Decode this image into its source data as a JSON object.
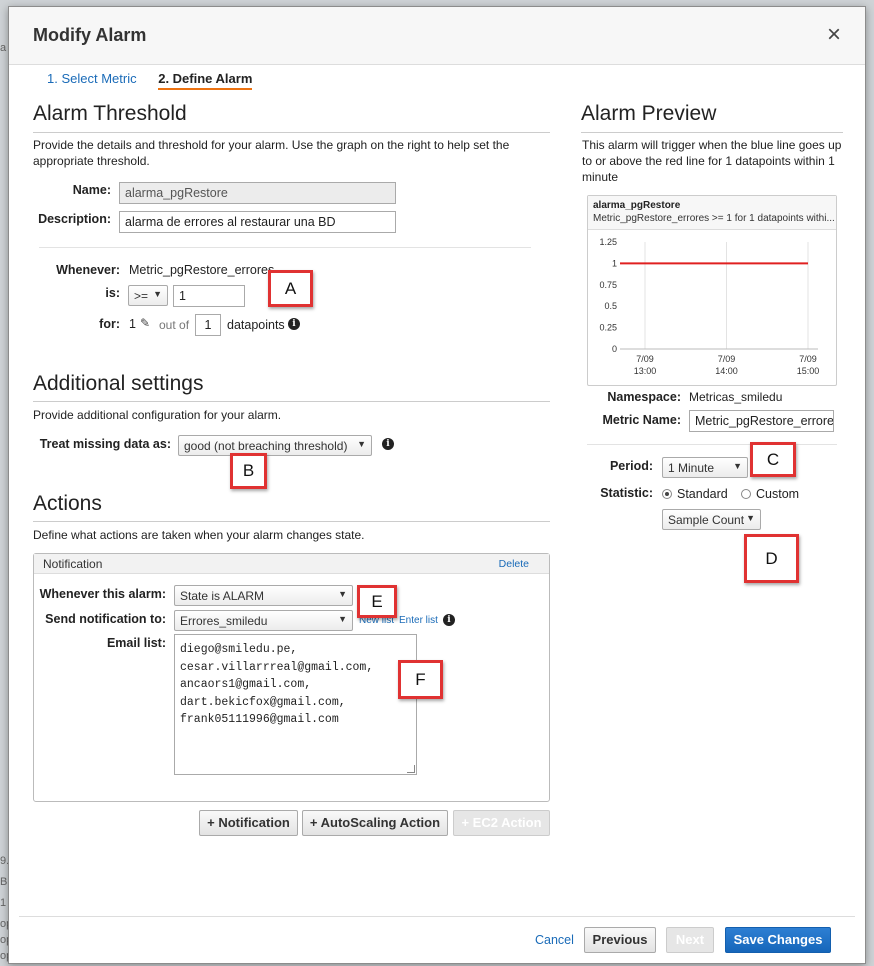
{
  "modal": {
    "title": "Modify Alarm",
    "close_glyph": "×"
  },
  "steps": [
    {
      "label": "1. Select Metric"
    },
    {
      "label": "2. Define Alarm"
    }
  ],
  "threshold": {
    "heading": "Alarm Threshold",
    "description": "Provide the details and threshold for your alarm. Use the graph on the right to help set the appropriate threshold.",
    "name_label": "Name:",
    "name_value": "alarma_pgRestore",
    "description_label": "Description:",
    "description_value": "alarma de errores al restaurar una BD",
    "whenever_label": "Whenever:",
    "whenever_value": "Metric_pgRestore_errores",
    "is_label": "is:",
    "operator": ">=",
    "threshold_value": "1",
    "for_label": "for:",
    "for_value": "1",
    "out_of": "out of",
    "datapoints_value": "1",
    "datapoints_label": "datapoints"
  },
  "additional": {
    "heading": "Additional settings",
    "description": "Provide additional configuration for your alarm.",
    "missing_label": "Treat missing data as:",
    "missing_value": "good (not breaching threshold)"
  },
  "actions": {
    "heading": "Actions",
    "description": "Define what actions are taken when your alarm changes state.",
    "notification_title": "Notification",
    "delete_label": "Delete",
    "whenever_alarm_label": "Whenever this alarm:",
    "state_value": "State is ALARM",
    "send_to_label": "Send notification to:",
    "topic_value": "Errores_smiledu",
    "new_list": "New list",
    "enter_list": "Enter list",
    "email_list_label": "Email list:",
    "emails": [
      "diego@smiledu.pe,",
      "cesar.villarrreal@gmail.com,",
      "ancaors1@gmail.com,",
      "dart.bekicfox@gmail.com,",
      "frank05111996@gmail.com"
    ],
    "add_notification": "+ Notification",
    "add_autoscaling": "+ AutoScaling Action",
    "add_ec2": "+ EC2 Action"
  },
  "preview": {
    "heading": "Alarm Preview",
    "description": "This alarm will trigger when the blue line goes up to or above the red line for 1 datapoints within 1 minute",
    "chart_title": "alarma_pgRestore",
    "chart_subtitle": "Metric_pgRestore_errores >= 1 for 1 datapoints withi...",
    "namespace_label": "Namespace:",
    "namespace_value": "Metricas_smiledu",
    "metric_name_label": "Metric Name:",
    "metric_name_value": "Metric_pgRestore_errores",
    "period_label": "Period:",
    "period_value": "1 Minute",
    "statistic_label": "Statistic:",
    "standard_label": "Standard",
    "custom_label": "Custom",
    "statistic_value": "Sample Count"
  },
  "chart_data": {
    "type": "line",
    "title": "alarma_pgRestore",
    "yticks": [
      "1.25",
      "1",
      "0.75",
      "0.5",
      "0.25",
      "0"
    ],
    "ylim": [
      0,
      1.25
    ],
    "xticks": [
      [
        "7/09",
        "13:00"
      ],
      [
        "7/09",
        "14:00"
      ],
      [
        "7/09",
        "15:00"
      ]
    ],
    "threshold": 1,
    "threshold_color": "#e02020",
    "grid": "vertical"
  },
  "callouts": [
    "A",
    "B",
    "C",
    "D",
    "E",
    "F"
  ],
  "footer": {
    "cancel": "Cancel",
    "previous": "Previous",
    "next": "Next",
    "save": "Save Changes"
  },
  "background": {
    "left_glyphs": [
      "a",
      "9.",
      "B",
      "1",
      "op",
      "op",
      "op"
    ]
  },
  "colors": {
    "accent": "#ec7211",
    "link": "#1a6bb8",
    "primary_button": "#1f72c6",
    "callout_border": "#e03232"
  }
}
